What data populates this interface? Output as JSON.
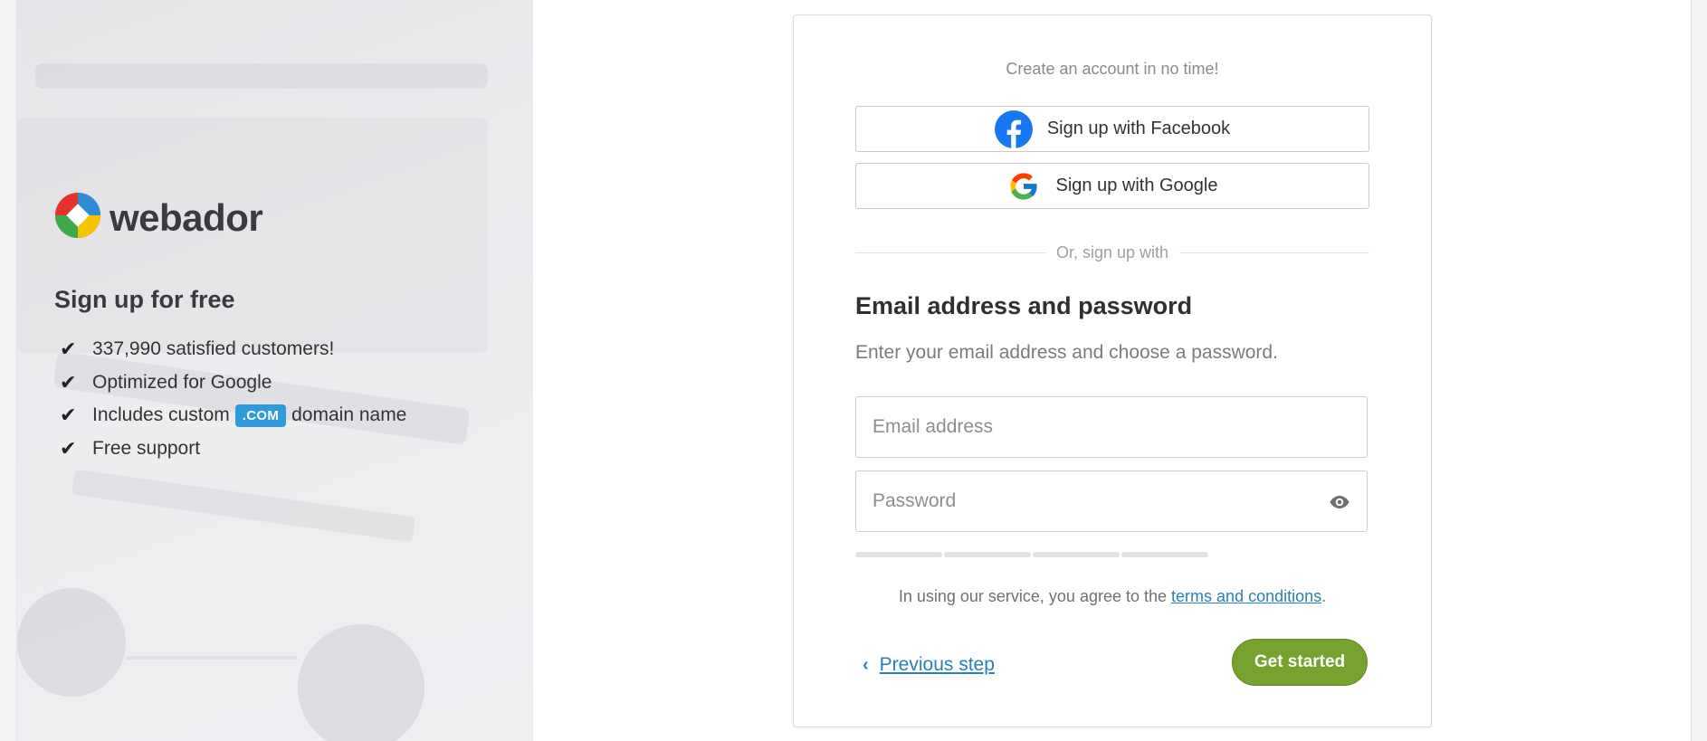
{
  "brand": {
    "name": "webador",
    "logo_colors": [
      "#e6322d",
      "#f5c400",
      "#3fa94a",
      "#2e8bd6"
    ]
  },
  "left": {
    "heading": "Sign up for free",
    "benefits": [
      {
        "check": "✔",
        "text": "337,990 satisfied customers!"
      },
      {
        "check": "✔",
        "text": "Optimized for Google"
      },
      {
        "check": "✔",
        "text_before": "Includes custom",
        "badge": ".COM",
        "text_after": "domain name"
      },
      {
        "check": "✔",
        "text": "Free support"
      }
    ]
  },
  "card": {
    "intro": "Create an account in no time!",
    "facebook_label": "Sign up with Facebook",
    "google_label": "Sign up with Google",
    "divider_text": "Or, sign up with",
    "form_title": "Email address and password",
    "form_subtitle": "Enter your email address and choose a password.",
    "email": {
      "placeholder": "Email address",
      "value": ""
    },
    "password": {
      "placeholder": "Password",
      "value": ""
    },
    "password_strength_level": 0,
    "terms_prefix": "In using our service, you agree to the",
    "terms_link": "terms and conditions",
    "terms_suffix": ".",
    "previous_chevron": "‹",
    "previous_label": "Previous step",
    "submit_label": "Get started"
  },
  "colors": {
    "accent_green": "#77a22f",
    "link_blue": "#2a7fb8",
    "badge_blue": "#2e9bdc",
    "facebook_blue": "#1877f2"
  },
  "icons": [
    "facebook-icon",
    "google-icon",
    "eye-icon",
    "chevron-left-icon",
    "check-icon",
    "webador-logo-icon"
  ]
}
